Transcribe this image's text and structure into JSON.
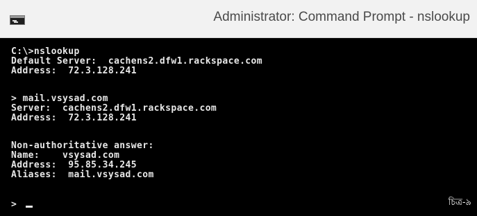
{
  "window": {
    "title": "Administrator: Command Prompt - nslookup"
  },
  "console": {
    "lines": [
      "C:\\>nslookup",
      "Default Server:  cachens2.dfw1.rackspace.com",
      "Address:  72.3.128.241",
      "> mail.vsysad.com",
      "Server:  cachens2.dfw1.rackspace.com",
      "Address:  72.3.128.241",
      "Non-authoritative answer:",
      "Name:    vsysad.com",
      "Address:  95.85.34.245",
      "Aliases:  mail.vsysad.com",
      ">"
    ]
  },
  "caption": "চিত্র-৯",
  "colors": {
    "titlebar_bg": "#f2f2f2",
    "console_bg": "#000000",
    "console_text": "#e8e8e8",
    "title_text": "#4a4a4a"
  },
  "icons": {
    "app": "command-prompt-icon",
    "cursor": "text-cursor"
  }
}
